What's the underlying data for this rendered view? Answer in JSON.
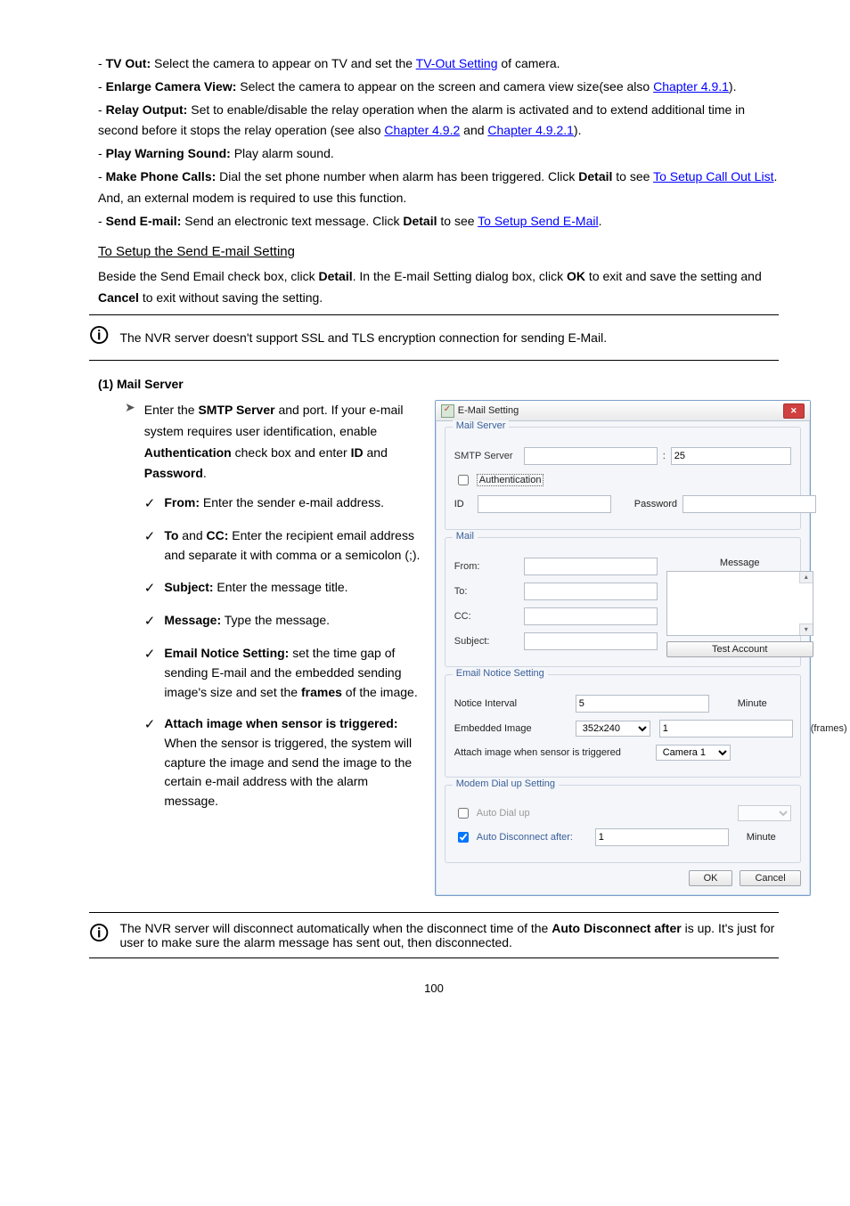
{
  "body": {
    "line1_a": "TV Out:",
    "line1_b": " Select the camera to appear on TV and set the ",
    "line1_link": "TV-Out Setting",
    "line1_c": " of camera.",
    "line2_a": "Enlarge Camera View: ",
    "line2_b": "Select the camera to appear on the screen and camera view size(see also ",
    "line2_link": "Chapter 4.9.1",
    "line2_c": ").",
    "line3_a": "Relay Output:",
    "line3_b": " Set to enable/disable the relay operation when the alarm is activated and to extend additional time in second before it stops the relay operation (see also ",
    "line3_link": "Chapter 4.9.2",
    "line3_c": " and ",
    "line3_link2": "Chapter 4.9.2.1",
    "line3_d": ").",
    "line4_a": "Play Warning Sound: ",
    "line4_b": "Play alarm sound.",
    "line5_a": "Make Phone Calls:",
    "line5_b": " Dial the set phone number when alarm has been triggered. Click ",
    "line5_c": "Detail ",
    "line5_d": "to see ",
    "line5_link": "To Setup Call Out List",
    "line5_e": ". And, an external modem is required to use this function.",
    "line6_a": "Send E-mail:",
    "line6_b": " Send an electronic text message. Click ",
    "line6_c": "Detail",
    "line6_d": " to see ",
    "line6_link": "To Setup Send E-Mail",
    "line6_e": ".",
    "sectionHead": "To Setup the Send E-mail Setting",
    "line7": "Beside the Send Email check box, click ",
    "line7_b": "Detail",
    "line7_c": ". In the E-mail Setting dialog box, click ",
    "line7_d": "OK",
    "line7_e": " to exit and save the setting and ",
    "line7_f": "Cancel ",
    "line7_g": "to exit without saving the setting.",
    "infoNote": "The NVR server doesn't support SSL and TLS encryption connection for sending E-Mail.",
    "subHead": "(1)   Mail Server",
    "mailServerIntro": "Enter the ",
    "mailServerBold": "SMTP Server",
    "mailServerRest": " and port. If your e-mail system requires user identification, enable ",
    "mailServerBold2": "Authentication",
    "mailServerRest2": " check box and enter ",
    "mailServerBold3": "ID",
    "mailServerRest3": " and ",
    "mailServerBold4": "Password",
    "mailServerRest4": ".",
    "checks": {
      "c1_a": "From: ",
      "c1_b": "Enter the sender e-mail address.",
      "c2_a": "To",
      "c2_b": " and ",
      "c2_c": "CC:",
      "c2_d": " Enter the recipient email address and separate it with comma or a semicolon (;).",
      "c3_a": "Subject:",
      "c3_b": " Enter the message title.",
      "c4_a": "Message:",
      "c4_b": " Type the message.",
      "c5_a": "Email Notice Setting: ",
      "c5_b": "set the time gap of sending E-mail and the embedded sending image's size and set the ",
      "c5_c": "frames",
      "c5_d": " of the image.",
      "c6_a": "Attach image when sensor is triggered:",
      "c6_b": " When the sensor is triggered, the system will capture the image and send the image to the certain e-mail address with the alarm message."
    },
    "info2a": "The NVR server will disconnect automatically when the disconnect time of the ",
    "info2b": "Auto Disconnect after",
    "info2c": " is up. It's just for user to make sure the alarm message has sent out, then disconnected.",
    "pageNum": "100"
  },
  "dialog": {
    "title": "E-Mail Setting",
    "groups": {
      "mailServer": "Mail Server",
      "mail": "Mail",
      "emailNotice": "Email Notice Setting",
      "modem": "Modem Dial up Setting"
    },
    "labels": {
      "smtp": "SMTP Server",
      "auth": "Authentication",
      "id": "ID",
      "password": "Password",
      "message": "Message",
      "from": "From:",
      "to": "To:",
      "cc": "CC:",
      "subject": "Subject:",
      "testAccount": "Test Account",
      "noticeInterval": "Notice Interval",
      "minute": "Minute",
      "embedded": "Embedded Image",
      "frames": "(frames)",
      "attach": "Attach image when sensor is triggered",
      "autoDial": "Auto Dial up",
      "autoDisc": "Auto Disconnect after:",
      "ok": "OK",
      "cancel": "Cancel"
    },
    "values": {
      "port": "25",
      "noticeInterval": "5",
      "embeddedSize": "352x240",
      "embeddedFrames": "1",
      "attachCamera": "Camera 1",
      "autoDiscMin": "1"
    }
  }
}
